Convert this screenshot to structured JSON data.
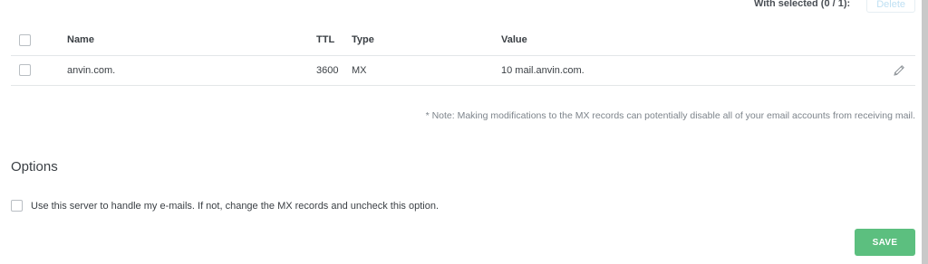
{
  "bulk": {
    "label": "With selected (0 / 1):",
    "delete_label": "Delete"
  },
  "table": {
    "headers": {
      "name": "Name",
      "ttl": "TTL",
      "type": "Type",
      "value": "Value"
    },
    "rows": [
      {
        "name": "anvin.com.",
        "ttl": "3600",
        "type": "MX",
        "value": "10 mail.anvin.com."
      }
    ]
  },
  "note": "* Note: Making modifications to the MX records can potentially disable all of your email accounts from receiving mail.",
  "options": {
    "title": "Options",
    "handle_email_label": "Use this server to handle my e-mails. If not, change the MX records and uncheck this option.",
    "handle_email_checked": false
  },
  "save_label": "SAVE",
  "colors": {
    "save_button": "#5cbf7f",
    "delete_disabled_text": "#bfe0f3",
    "divider": "#e3e6e8"
  },
  "icons": {
    "edit": "pencil-icon"
  }
}
